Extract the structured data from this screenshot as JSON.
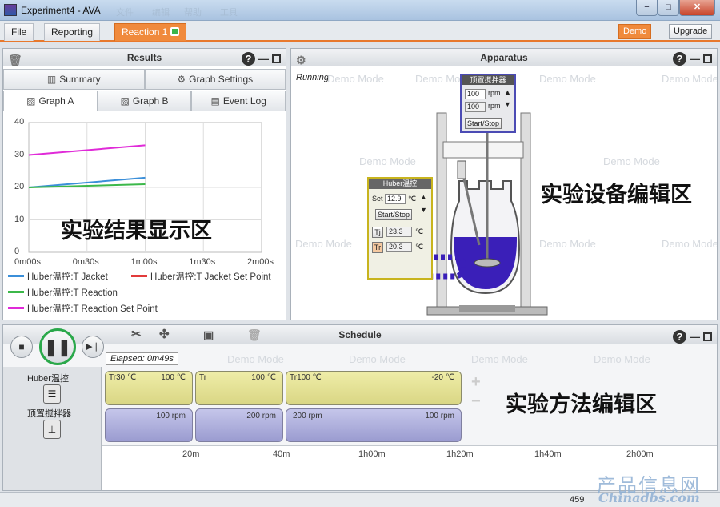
{
  "window": {
    "title": "Experiment4 - AVA",
    "ghost_menu": [
      "文件",
      "编辑",
      "帮助",
      "工具"
    ],
    "minimize": "−",
    "maximize": "□",
    "close": "✕"
  },
  "menubar": {
    "tabs": [
      {
        "label": "File"
      },
      {
        "label": "Reporting"
      },
      {
        "label": "Reaction 1"
      }
    ],
    "demo_label": "Demo",
    "upgrade_label": "Upgrade"
  },
  "results": {
    "title": "Results",
    "tabs_top": [
      {
        "icon": "▥",
        "label": "Summary"
      },
      {
        "icon": "⚙",
        "label": "Graph Settings"
      }
    ],
    "tabs_bottom": [
      {
        "icon": "▨",
        "label": "Graph A"
      },
      {
        "icon": "▨",
        "label": "Graph B"
      },
      {
        "icon": "▤",
        "label": "Event Log"
      }
    ],
    "overlay": "实验结果显示区"
  },
  "chart_data": {
    "type": "line",
    "x_ticks": [
      "0m00s",
      "0m30s",
      "1m00s",
      "1m30s",
      "2m00s"
    ],
    "y_ticks": [
      "0",
      "10",
      "20",
      "30",
      "40"
    ],
    "ylim": [
      0,
      40
    ],
    "series": [
      {
        "name": "Huber温控:T Jacket",
        "color": "#3b8fd9",
        "points": [
          [
            0,
            20
          ],
          [
            60,
            23
          ]
        ]
      },
      {
        "name": "Huber温控:T Jacket Set Point",
        "color": "#e23b3b",
        "points": []
      },
      {
        "name": "Huber温控:T Reaction",
        "color": "#3cb84a",
        "points": [
          [
            0,
            20
          ],
          [
            60,
            21
          ]
        ]
      },
      {
        "name": "Huber温控:T Reaction Set Point",
        "color": "#e02ad8",
        "points": [
          [
            0,
            30
          ],
          [
            60,
            33
          ]
        ]
      }
    ]
  },
  "apparatus": {
    "title": "Apparatus",
    "status": "Running",
    "overlay": "实验设备编辑区",
    "watermark": "Demo Mode",
    "stirrer": {
      "title": "顶置搅拌器",
      "speed_value": "100",
      "speed_unit": "rpm",
      "speed_actual": "100",
      "speed_actual_unit": "rpm",
      "start_stop": "Start/Stop"
    },
    "huber": {
      "title": "Huber温控",
      "set_label": "Set",
      "set_value": "12.9",
      "unit": "℃",
      "start_stop": "Start/Stop",
      "tj_icon": "Tj",
      "tj_value": "23.3",
      "tr_icon": "Tr",
      "tr_value": "20.3"
    }
  },
  "schedule": {
    "title": "Schedule",
    "elapsed": "Elapsed: 0m49s",
    "overlay": "实验方法编辑区",
    "watermark": "Demo Mode",
    "devices": [
      {
        "label": "Huber温控",
        "icon": "thermo-control-icon"
      },
      {
        "label": "顶置搅拌器",
        "icon": "stirrer-icon"
      }
    ],
    "temp_segments": [
      {
        "left": "Tr30 ℃",
        "right": "100 ℃"
      },
      {
        "left": "Tr",
        "right": "100 ℃"
      },
      {
        "left": "Tr100 ℃",
        "right": "-20 ℃"
      }
    ],
    "stir_segments": [
      {
        "left": "",
        "right": "100 rpm"
      },
      {
        "left": "",
        "right": "200 rpm"
      },
      {
        "left": "200 rpm",
        "right": "100 rpm"
      }
    ],
    "time_ticks": [
      "20m",
      "40m",
      "1h00m",
      "1h20m",
      "1h40m",
      "2h00m"
    ],
    "add_label": "+",
    "remove_label": "−"
  },
  "statusbar": {
    "text": "459"
  },
  "corner_watermark": {
    "cn": "产品信息网",
    "en": "Chinadbs.com"
  }
}
